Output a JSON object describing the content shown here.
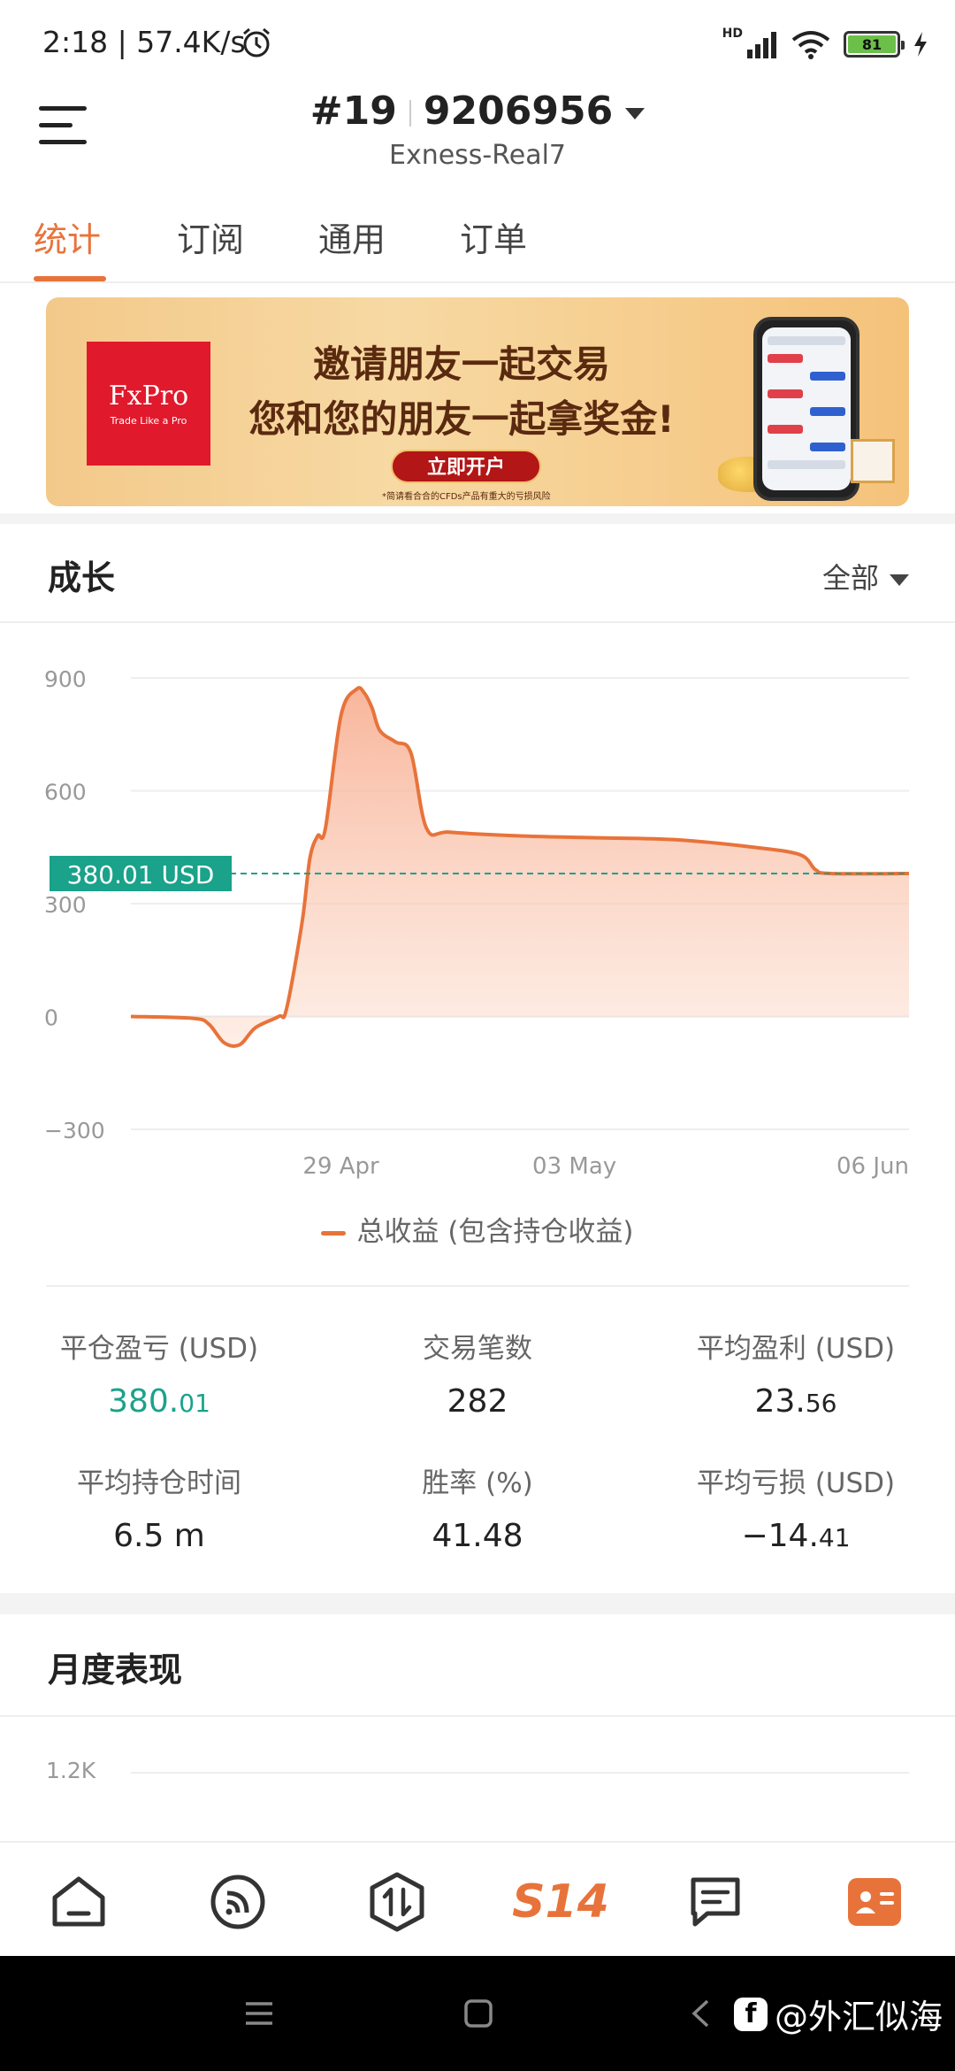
{
  "status_bar": {
    "time_speed": "2:18 | 57.4K/s",
    "network_badge": "HD",
    "battery": "81"
  },
  "header": {
    "account_prefix": "#19",
    "account_number": "9206956",
    "server": "Exness-Real7"
  },
  "tabs": [
    {
      "label": "统计",
      "active": true
    },
    {
      "label": "订阅",
      "active": false
    },
    {
      "label": "通用",
      "active": false
    },
    {
      "label": "订单",
      "active": false
    }
  ],
  "banner": {
    "brand": "FxPro",
    "brand_tagline": "Trade Like a Pro",
    "line1": "邀请朋友一起交易",
    "line2": "您和您的朋友一起拿奖金!",
    "button": "立即开户",
    "disclaimer": "*简请看合合的CFDs产品有重大的亏损风险"
  },
  "growth": {
    "title": "成长",
    "range": "全部"
  },
  "chart_data": {
    "type": "area",
    "series": [
      {
        "name": "总收益 (包含持仓收益)",
        "color": "#e8733a",
        "x_norm": [
          0.0,
          0.08,
          0.1,
          0.12,
          0.14,
          0.16,
          0.19,
          0.2,
          0.22,
          0.23,
          0.24,
          0.25,
          0.27,
          0.29,
          0.3,
          0.31,
          0.32,
          0.34,
          0.36,
          0.38,
          0.41,
          0.5,
          0.6,
          0.7,
          0.8,
          0.86,
          0.88,
          0.9,
          1.0
        ],
        "values": [
          0,
          -5,
          -20,
          -70,
          -75,
          -30,
          0,
          20,
          250,
          420,
          480,
          500,
          800,
          870,
          860,
          820,
          760,
          730,
          700,
          500,
          490,
          480,
          475,
          470,
          450,
          430,
          390,
          380,
          380
        ]
      }
    ],
    "y_ticks": [
      "900",
      "600",
      "300",
      "0",
      "−300"
    ],
    "ylim": [
      -300,
      900
    ],
    "x_ticks": [
      {
        "label": "29 Apr",
        "pos": 0.27
      },
      {
        "label": "03 May",
        "pos": 0.57
      },
      {
        "label": "06 Jun",
        "pos": 1.0
      }
    ],
    "current_value_label": "380.01 USD",
    "current_value": 380.01,
    "legend": "总收益 (包含持仓收益)"
  },
  "stats": {
    "closed_pnl_label": "平仓盈亏 (USD)",
    "closed_pnl_main": "380.",
    "closed_pnl_decimal": "01",
    "trades_label": "交易笔数",
    "trades_value": "282",
    "avg_profit_label": "平均盈利 (USD)",
    "avg_profit_main": "23.",
    "avg_profit_decimal": "56",
    "avg_hold_label": "平均持仓时间",
    "avg_hold_value": "6.5 m",
    "win_rate_label": "胜率 (%)",
    "win_rate_value": "41.48",
    "avg_loss_label": "平均亏损 (USD)",
    "avg_loss_main": "−14.",
    "avg_loss_decimal": "41"
  },
  "monthly": {
    "title": "月度表现",
    "first_tick": "1.2K"
  },
  "bottom_nav": {
    "s14_label": "S14"
  },
  "watermark": {
    "text": "@外汇似海",
    "badge": "f"
  }
}
